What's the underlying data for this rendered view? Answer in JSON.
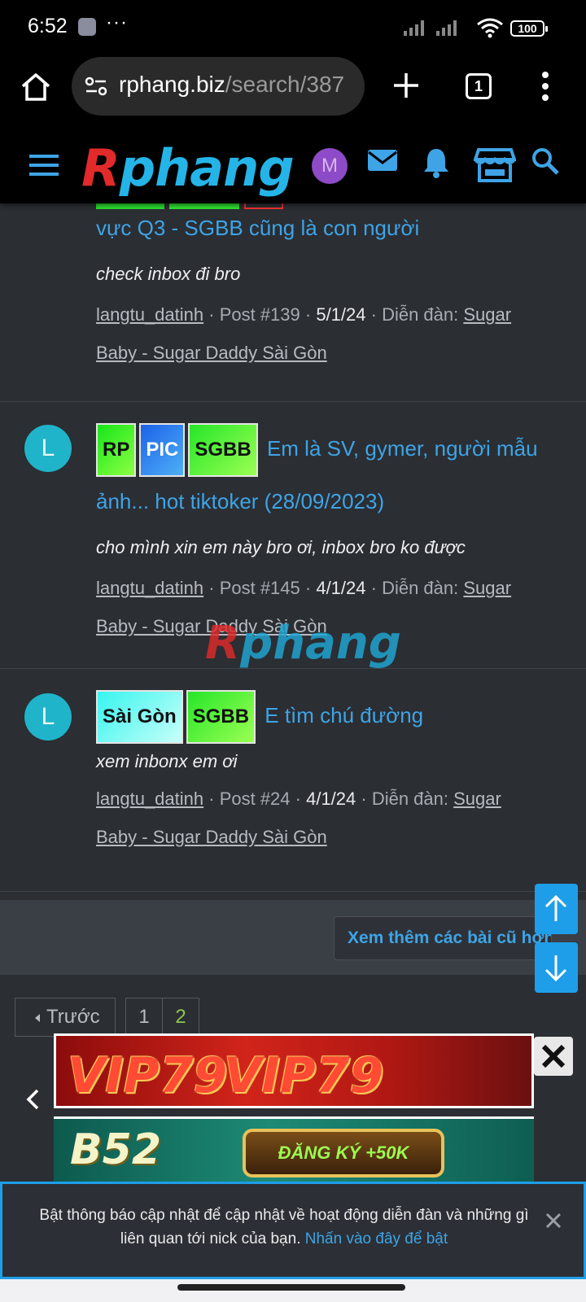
{
  "status_bar": {
    "time": "6:52",
    "overflow": "···",
    "battery": "100"
  },
  "browser": {
    "url_domain": "rphang.biz",
    "url_path": "/search/387",
    "tab_count": "1"
  },
  "site": {
    "logo_first": "R",
    "logo_rest": "phang",
    "avatar_letter": "M"
  },
  "results": [
    {
      "title": "vực Q3 - SGBB cũng là con người",
      "snippet": "check inbox đi bro",
      "author": "langtu_datinh",
      "sep1": " · ",
      "post": "Post #139",
      "sep2": " · ",
      "date": "5/1/24",
      "sep3": " · ",
      "forum_label": "Diễn đàn: ",
      "forum": "Sugar Baby - Sugar Daddy Sài Gòn"
    },
    {
      "avatar": "L",
      "tags": [
        "RP",
        "PIC",
        "SGBB"
      ],
      "title": "Em là SV, gymer, người mẫu ảnh... hot tiktoker (28/09/2023)",
      "snippet": "cho mình xin em này bro ơi, inbox bro ko được",
      "author": "langtu_datinh",
      "post": "Post #145",
      "date": "4/1/24",
      "forum_label": "Diễn đàn: ",
      "forum": "Sugar Baby - Sugar Daddy Sài Gòn"
    },
    {
      "avatar": "L",
      "tags": [
        "Sài Gòn",
        "SGBB"
      ],
      "title": "E tìm chú đường",
      "snippet": "xem inbonx em ơi",
      "author": "langtu_datinh",
      "post": "Post #24",
      "date": "4/1/24",
      "forum_label": "Diễn đàn: ",
      "forum": "Sugar Baby - Sugar Daddy Sài Gòn"
    }
  ],
  "more_button": "Xem thêm các bài cũ hơn",
  "pagination": {
    "prev": "Trước",
    "pages": [
      "1",
      "2"
    ],
    "current": "2"
  },
  "ads": {
    "ad1_text": "VIP79",
    "ad2_brand": "B52",
    "ad2_cta": "ĐĂNG KÝ +50K"
  },
  "notice": {
    "message": "Bật thông báo cập nhật để cập nhật về hoạt động diễn đàn và những gì liên quan tới nick của bạn.",
    "link": "Nhấn vào đây để bật"
  },
  "colors": {
    "link": "#3ea4e6",
    "accent": "#1e9ee9",
    "avatar_teal": "#1fb4c9",
    "avatar_purple": "#8e4bc7"
  }
}
